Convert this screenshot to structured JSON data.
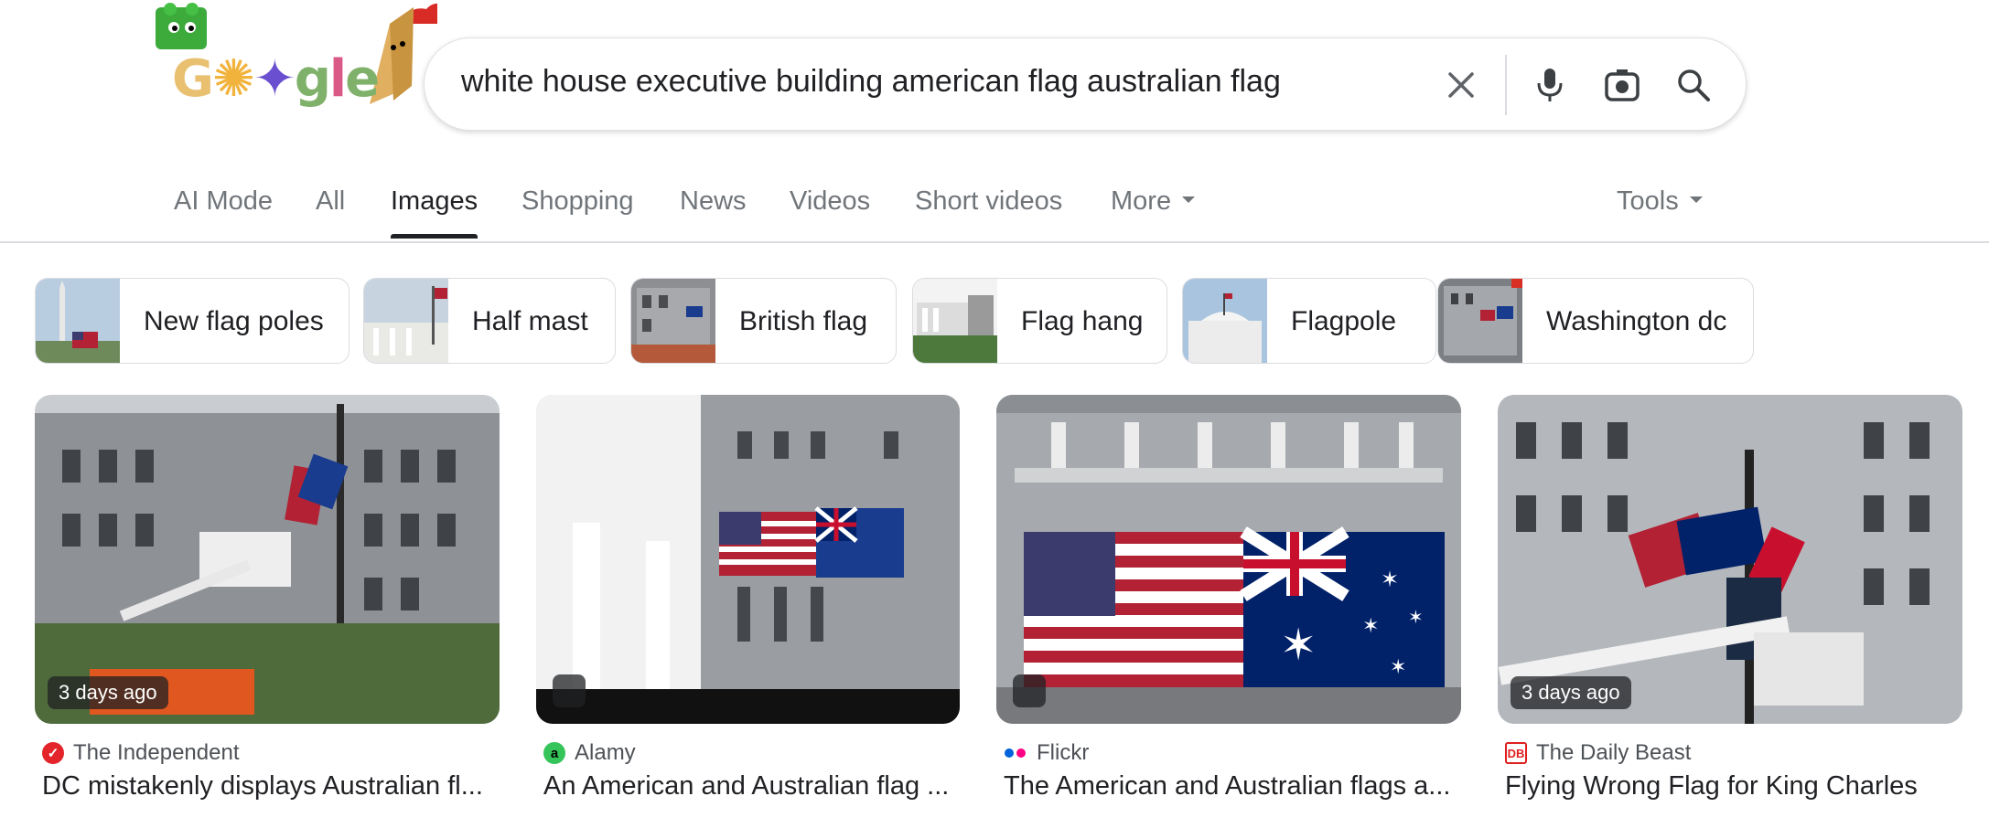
{
  "logo": {
    "text": "Google"
  },
  "search": {
    "query": "white house executive building american flag australian flag"
  },
  "tabs": [
    {
      "label": "AI Mode"
    },
    {
      "label": "All"
    },
    {
      "label": "Images"
    },
    {
      "label": "Shopping"
    },
    {
      "label": "News"
    },
    {
      "label": "Videos"
    },
    {
      "label": "Short videos"
    },
    {
      "label": "More"
    }
  ],
  "tools_label": "Tools",
  "chips": [
    {
      "label": "New flag poles"
    },
    {
      "label": "Half mast"
    },
    {
      "label": "British flag"
    },
    {
      "label": "Flag hang"
    },
    {
      "label": "Flagpole"
    },
    {
      "label": "Washington dc"
    }
  ],
  "results": [
    {
      "source": "The Independent",
      "title": "DC mistakenly displays Australian fl...",
      "badge": "3 days ago"
    },
    {
      "source": "Alamy",
      "title": "An American and Australian flag ..."
    },
    {
      "source": "Flickr",
      "title": "The American and Australian flags a..."
    },
    {
      "source": "The Daily Beast",
      "title": "Flying Wrong Flag for King Charles",
      "badge": "3 days ago"
    }
  ],
  "colors": {
    "active_tab": "#202124",
    "inactive_tab": "#70757a",
    "border": "#dadce0"
  }
}
